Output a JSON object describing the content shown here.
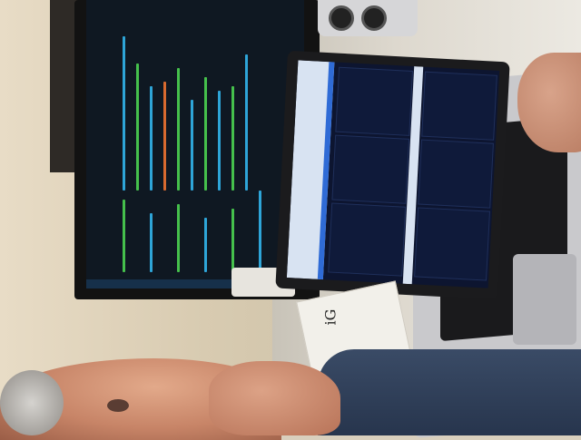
{
  "scene": {
    "description_label": "",
    "paper_text": "iG"
  },
  "colors": {
    "monitor_code_green": "#45c04c",
    "monitor_code_blue": "#2ea5d8",
    "monitor_code_orange": "#d96a2f",
    "monitor_bg": "#0f1822",
    "laptop_panel": "#0f1a3a"
  }
}
